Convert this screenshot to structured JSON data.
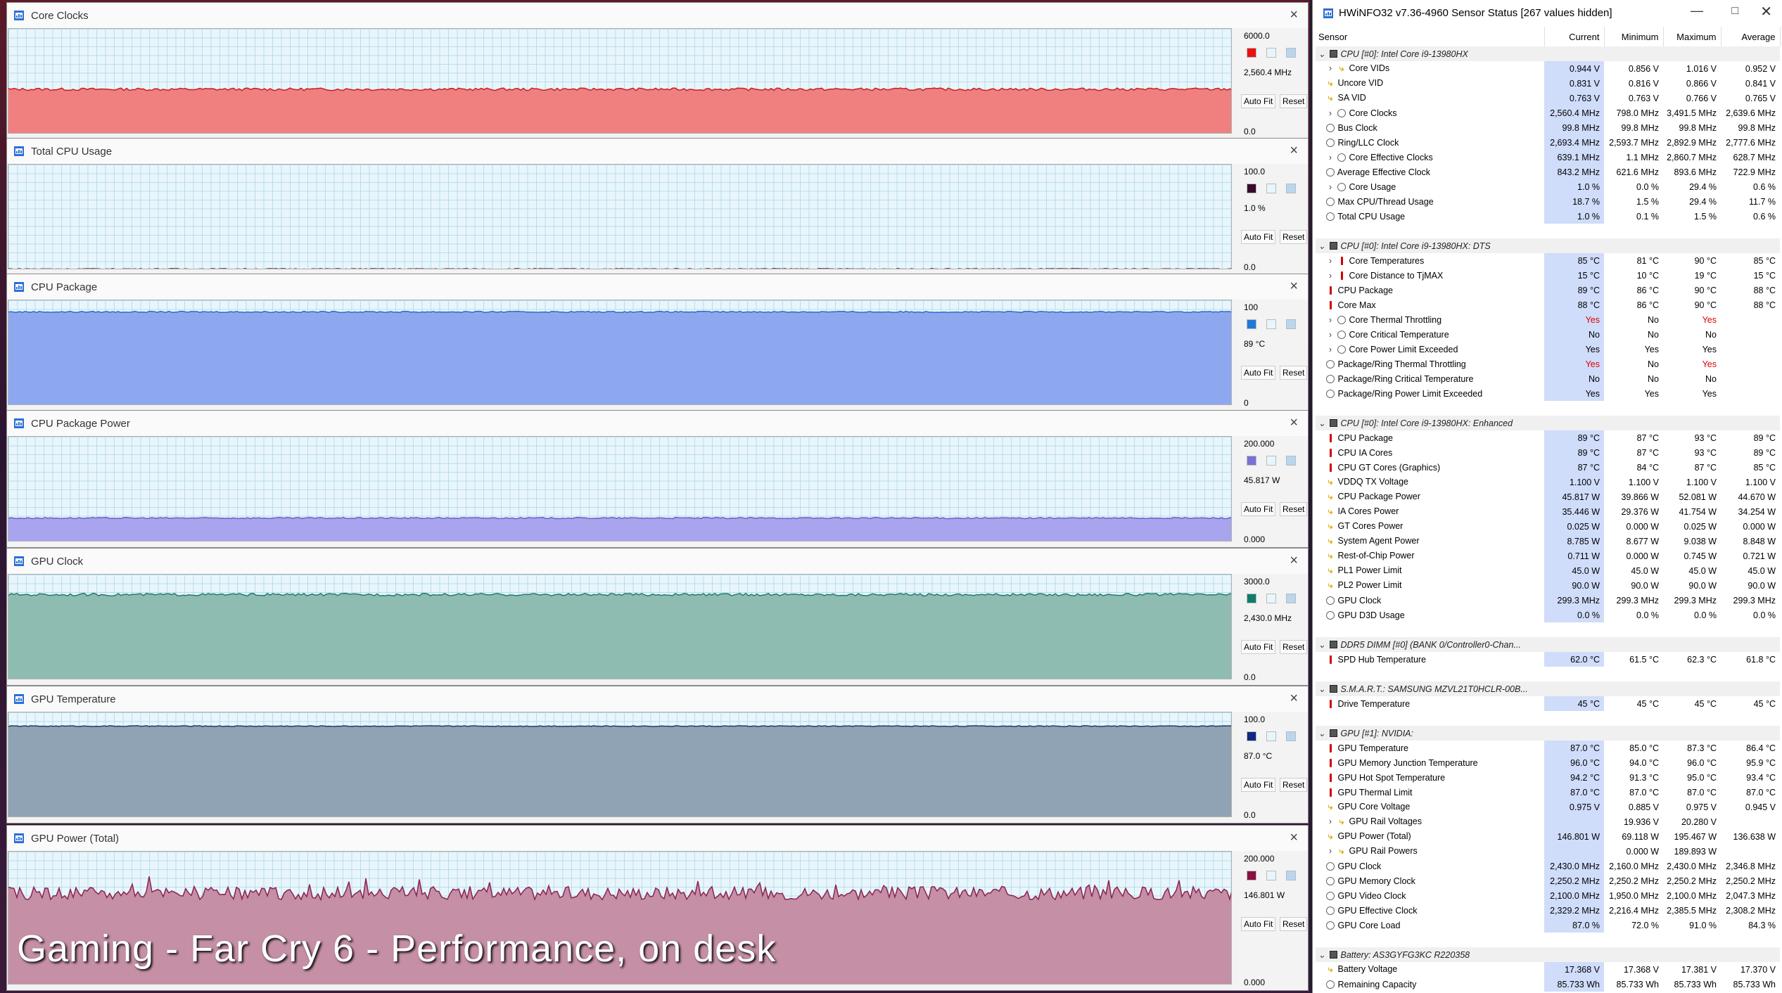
{
  "overlay_caption": "Gaming - Far Cry 6 - Performance, on desk",
  "graph_windows": [
    {
      "title": "Core Clocks",
      "max": "6000.0",
      "current": "2,560.4 MHz",
      "min": "0.0",
      "color": "#f08080",
      "line": "#c81e1e",
      "swatch": "#e81212",
      "level": 0.427,
      "jitter": 0.012
    },
    {
      "title": "Total CPU Usage",
      "max": "100.0",
      "current": "1.0 %",
      "min": "0.0",
      "color": "none",
      "line": "#4a0a2a",
      "swatch": "#3a0a2a",
      "level": 0.01,
      "jitter": 0.004
    },
    {
      "title": "CPU Package",
      "max": "100",
      "current": "89 °C",
      "min": "0",
      "color": "#8ea8f0",
      "line": "#2b6cc4",
      "swatch": "#1e7ad8",
      "level": 0.89,
      "jitter": 0.006
    },
    {
      "title": "CPU Package Power",
      "max": "200.000",
      "current": "45.817 W",
      "min": "0.000",
      "color": "#a9a4ee",
      "line": "#6a5ecb",
      "swatch": "#7b70d6",
      "level": 0.229,
      "jitter": 0.006
    },
    {
      "title": "GPU Clock",
      "max": "3000.0",
      "current": "2,430.0 MHz",
      "min": "0.0",
      "color": "#8fbcb0",
      "line": "#1f7d6c",
      "swatch": "#0e7d6c",
      "level": 0.81,
      "jitter": 0.012
    },
    {
      "title": "GPU Temperature",
      "max": "100.0",
      "current": "87.0 °C",
      "min": "0.0",
      "color": "#8fa3b4",
      "line": "#1f3f6a",
      "swatch": "#0e2a80",
      "level": 0.87,
      "jitter": 0.004
    },
    {
      "title": "GPU Power (Total)",
      "max": "200.000",
      "current": "146.801 W",
      "min": "0.000",
      "color": "#c58fa6",
      "line": "#8a2350",
      "swatch": "#8a1040",
      "level": 0.69,
      "jitter": 0.05
    }
  ],
  "graph_buttons": {
    "auto_fit": "Auto Fit",
    "reset": "Reset"
  },
  "hwinfo": {
    "title": "HWiNFO32 v7.36-4960 Sensor Status [267 values hidden]",
    "columns": [
      "Sensor",
      "Current",
      "Minimum",
      "Maximum",
      "Average"
    ],
    "rows": [
      {
        "t": "g",
        "n": "CPU [#0]: Intel Core i9-13980HX"
      },
      {
        "i": "bolt",
        "x": 1,
        "n": "Core VIDs",
        "c": "0.944 V",
        "mn": "0.856 V",
        "mx": "1.016 V",
        "av": "0.952 V"
      },
      {
        "i": "bolt",
        "n": "Uncore VID",
        "c": "0.831 V",
        "mn": "0.816 V",
        "mx": "0.866 V",
        "av": "0.841 V"
      },
      {
        "i": "bolt",
        "n": "SA VID",
        "c": "0.763 V",
        "mn": "0.763 V",
        "mx": "0.766 V",
        "av": "0.765 V"
      },
      {
        "i": "meter",
        "x": 1,
        "n": "Core Clocks",
        "c": "2,560.4 MHz",
        "mn": "798.0 MHz",
        "mx": "3,491.5 MHz",
        "av": "2,639.6 MHz"
      },
      {
        "i": "meter",
        "n": "Bus Clock",
        "c": "99.8 MHz",
        "mn": "99.8 MHz",
        "mx": "99.8 MHz",
        "av": "99.8 MHz"
      },
      {
        "i": "meter",
        "n": "Ring/LLC Clock",
        "c": "2,693.4 MHz",
        "mn": "2,593.7 MHz",
        "mx": "2,892.9 MHz",
        "av": "2,777.6 MHz"
      },
      {
        "i": "meter",
        "x": 1,
        "n": "Core Effective Clocks",
        "c": "639.1 MHz",
        "mn": "1.1 MHz",
        "mx": "2,860.7 MHz",
        "av": "628.7 MHz"
      },
      {
        "i": "meter",
        "n": "Average Effective Clock",
        "c": "843.2 MHz",
        "mn": "621.6 MHz",
        "mx": "893.6 MHz",
        "av": "722.9 MHz"
      },
      {
        "i": "meter",
        "x": 1,
        "n": "Core Usage",
        "c": "1.0 %",
        "mn": "0.0 %",
        "mx": "29.4 %",
        "av": "0.6 %"
      },
      {
        "i": "meter",
        "n": "Max CPU/Thread Usage",
        "c": "18.7 %",
        "mn": "1.5 %",
        "mx": "29.4 %",
        "av": "11.7 %"
      },
      {
        "i": "meter",
        "n": "Total CPU Usage",
        "c": "1.0 %",
        "mn": "0.1 %",
        "mx": "1.5 %",
        "av": "0.6 %"
      },
      {
        "t": "s"
      },
      {
        "t": "g",
        "n": "CPU [#0]: Intel Core i9-13980HX: DTS"
      },
      {
        "i": "temp",
        "x": 1,
        "n": "Core Temperatures",
        "c": "85 °C",
        "mn": "81 °C",
        "mx": "90 °C",
        "av": "85 °C"
      },
      {
        "i": "temp",
        "x": 1,
        "n": "Core Distance to TjMAX",
        "c": "15 °C",
        "mn": "10 °C",
        "mx": "19 °C",
        "av": "15 °C"
      },
      {
        "i": "temp",
        "n": "CPU Package",
        "c": "89 °C",
        "mn": "86 °C",
        "mx": "90 °C",
        "av": "88 °C"
      },
      {
        "i": "temp",
        "n": "Core Max",
        "c": "88 °C",
        "mn": "86 °C",
        "mx": "90 °C",
        "av": "88 °C"
      },
      {
        "i": "meter",
        "x": 1,
        "n": "Core Thermal Throttling",
        "c": "Yes",
        "mn": "No",
        "mx": "Yes",
        "av": "",
        "rc": 1,
        "rx": 1
      },
      {
        "i": "meter",
        "x": 1,
        "n": "Core Critical Temperature",
        "c": "No",
        "mn": "No",
        "mx": "No",
        "av": ""
      },
      {
        "i": "meter",
        "x": 1,
        "n": "Core Power Limit Exceeded",
        "c": "Yes",
        "mn": "Yes",
        "mx": "Yes",
        "av": ""
      },
      {
        "i": "meter",
        "n": "Package/Ring Thermal Throttling",
        "c": "Yes",
        "mn": "No",
        "mx": "Yes",
        "av": "",
        "rc": 1,
        "rx": 1
      },
      {
        "i": "meter",
        "n": "Package/Ring Critical Temperature",
        "c": "No",
        "mn": "No",
        "mx": "No",
        "av": ""
      },
      {
        "i": "meter",
        "n": "Package/Ring Power Limit Exceeded",
        "c": "Yes",
        "mn": "Yes",
        "mx": "Yes",
        "av": ""
      },
      {
        "t": "s"
      },
      {
        "t": "g",
        "n": "CPU [#0]: Intel Core i9-13980HX: Enhanced"
      },
      {
        "i": "temp",
        "n": "CPU Package",
        "c": "89 °C",
        "mn": "87 °C",
        "mx": "93 °C",
        "av": "89 °C"
      },
      {
        "i": "temp",
        "n": "CPU IA Cores",
        "c": "89 °C",
        "mn": "87 °C",
        "mx": "93 °C",
        "av": "89 °C"
      },
      {
        "i": "temp",
        "n": "CPU GT Cores (Graphics)",
        "c": "87 °C",
        "mn": "84 °C",
        "mx": "87 °C",
        "av": "85 °C"
      },
      {
        "i": "bolt",
        "n": "VDDQ TX Voltage",
        "c": "1.100 V",
        "mn": "1.100 V",
        "mx": "1.100 V",
        "av": "1.100 V"
      },
      {
        "i": "bolt",
        "n": "CPU Package Power",
        "c": "45.817 W",
        "mn": "39.866 W",
        "mx": "52.081 W",
        "av": "44.670 W"
      },
      {
        "i": "bolt",
        "n": "IA Cores Power",
        "c": "35.446 W",
        "mn": "29.376 W",
        "mx": "41.754 W",
        "av": "34.254 W"
      },
      {
        "i": "bolt",
        "n": "GT Cores Power",
        "c": "0.025 W",
        "mn": "0.000 W",
        "mx": "0.025 W",
        "av": "0.000 W"
      },
      {
        "i": "bolt",
        "n": "System Agent Power",
        "c": "8.785 W",
        "mn": "8.677 W",
        "mx": "9.038 W",
        "av": "8.848 W"
      },
      {
        "i": "bolt",
        "n": "Rest-of-Chip Power",
        "c": "0.711 W",
        "mn": "0.000 W",
        "mx": "0.745 W",
        "av": "0.721 W"
      },
      {
        "i": "bolt",
        "n": "PL1 Power Limit",
        "c": "45.0 W",
        "mn": "45.0 W",
        "mx": "45.0 W",
        "av": "45.0 W"
      },
      {
        "i": "bolt",
        "n": "PL2 Power Limit",
        "c": "90.0 W",
        "mn": "90.0 W",
        "mx": "90.0 W",
        "av": "90.0 W"
      },
      {
        "i": "meter",
        "n": "GPU Clock",
        "c": "299.3 MHz",
        "mn": "299.3 MHz",
        "mx": "299.3 MHz",
        "av": "299.3 MHz"
      },
      {
        "i": "meter",
        "n": "GPU D3D Usage",
        "c": "0.0 %",
        "mn": "0.0 %",
        "mx": "0.0 %",
        "av": "0.0 %"
      },
      {
        "t": "s"
      },
      {
        "t": "g",
        "n": "DDR5 DIMM [#0] (BANK 0/Controller0-Chan..."
      },
      {
        "i": "temp",
        "n": "SPD Hub Temperature",
        "c": "62.0 °C",
        "mn": "61.5 °C",
        "mx": "62.3 °C",
        "av": "61.8 °C"
      },
      {
        "t": "s"
      },
      {
        "t": "g",
        "n": "S.M.A.R.T.: SAMSUNG MZVL21T0HCLR-00B..."
      },
      {
        "i": "temp",
        "n": "Drive Temperature",
        "c": "45 °C",
        "mn": "45 °C",
        "mx": "45 °C",
        "av": "45 °C"
      },
      {
        "t": "s"
      },
      {
        "t": "g",
        "n": "GPU [#1]: NVIDIA:"
      },
      {
        "i": "temp",
        "n": "GPU Temperature",
        "c": "87.0 °C",
        "mn": "85.0 °C",
        "mx": "87.3 °C",
        "av": "86.4 °C"
      },
      {
        "i": "temp",
        "n": "GPU Memory Junction Temperature",
        "c": "96.0 °C",
        "mn": "94.0 °C",
        "mx": "96.0 °C",
        "av": "95.9 °C"
      },
      {
        "i": "temp",
        "n": "GPU Hot Spot Temperature",
        "c": "94.2 °C",
        "mn": "91.3 °C",
        "mx": "95.0 °C",
        "av": "93.4 °C"
      },
      {
        "i": "temp",
        "n": "GPU Thermal Limit",
        "c": "87.0 °C",
        "mn": "87.0 °C",
        "mx": "87.0 °C",
        "av": "87.0 °C"
      },
      {
        "i": "bolt",
        "n": "GPU Core Voltage",
        "c": "0.975 V",
        "mn": "0.885 V",
        "mx": "0.975 V",
        "av": "0.945 V"
      },
      {
        "i": "bolt",
        "x": 1,
        "n": "GPU Rail Voltages",
        "c": "",
        "mn": "19.936 V",
        "mx": "20.280 V",
        "av": ""
      },
      {
        "i": "bolt",
        "n": "GPU Power (Total)",
        "c": "146.801 W",
        "mn": "69.118 W",
        "mx": "195.467 W",
        "av": "136.638 W"
      },
      {
        "i": "bolt",
        "x": 1,
        "n": "GPU Rail Powers",
        "c": "",
        "mn": "0.000 W",
        "mx": "189.893 W",
        "av": ""
      },
      {
        "i": "meter",
        "n": "GPU Clock",
        "c": "2,430.0 MHz",
        "mn": "2,160.0 MHz",
        "mx": "2,430.0 MHz",
        "av": "2,346.8 MHz"
      },
      {
        "i": "meter",
        "n": "GPU Memory Clock",
        "c": "2,250.2 MHz",
        "mn": "2,250.2 MHz",
        "mx": "2,250.2 MHz",
        "av": "2,250.2 MHz"
      },
      {
        "i": "meter",
        "n": "GPU Video Clock",
        "c": "2,100.0 MHz",
        "mn": "1,950.0 MHz",
        "mx": "2,100.0 MHz",
        "av": "2,047.3 MHz"
      },
      {
        "i": "meter",
        "n": "GPU Effective Clock",
        "c": "2,329.2 MHz",
        "mn": "2,216.4 MHz",
        "mx": "2,385.5 MHz",
        "av": "2,308.2 MHz"
      },
      {
        "i": "meter",
        "n": "GPU Core Load",
        "c": "87.0 %",
        "mn": "72.0 %",
        "mx": "91.0 %",
        "av": "84.3 %"
      },
      {
        "t": "s"
      },
      {
        "t": "g",
        "n": "Battery: AS3GYFG3KC R220358"
      },
      {
        "i": "bolt",
        "n": "Battery Voltage",
        "c": "17.368 V",
        "mn": "17.368 V",
        "mx": "17.381 V",
        "av": "17.370 V"
      },
      {
        "i": "meter",
        "n": "Remaining Capacity",
        "c": "85.733 Wh",
        "mn": "85.733 Wh",
        "mx": "85.733 Wh",
        "av": "85.733 Wh"
      }
    ]
  }
}
